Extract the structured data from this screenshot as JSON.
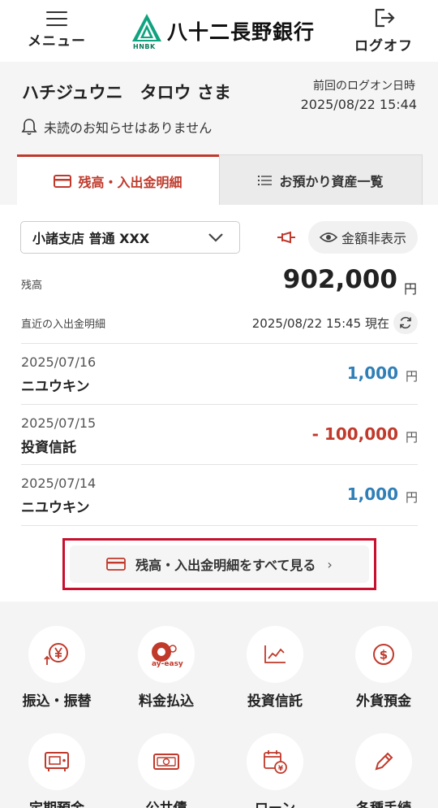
{
  "header": {
    "menu_label": "メニュー",
    "bank_name": "八十二長野銀行",
    "logo_sub": "HNBK",
    "logout_label": "ログオフ"
  },
  "user": {
    "name": "ハチジュウニ　タロウ さま",
    "last_logon_label": "前回のログオン日時",
    "last_logon_time": "2025/08/22 15:44",
    "notice": "未読のお知らせはありません"
  },
  "tabs": [
    {
      "label": "残高・入出金明細",
      "active": true
    },
    {
      "label": "お預かり資産一覧",
      "active": false
    }
  ],
  "account": {
    "selected": "小諸支店 普通 XXX",
    "hide_amount_label": "金額非表示",
    "balance_label": "残高",
    "balance_value": "902,000",
    "currency_unit": "円",
    "recent_label": "直近の入出金明細",
    "recent_time": "2025/08/22 15:45 現在"
  },
  "transactions": [
    {
      "date": "2025/07/16",
      "desc": "ニユウキン",
      "amount": "1,000",
      "unit": "円",
      "type": "deposit"
    },
    {
      "date": "2025/07/15",
      "desc": "投資信託",
      "amount": "- 100,000",
      "unit": "円",
      "type": "withdrawal"
    },
    {
      "date": "2025/07/14",
      "desc": "ニユウキン",
      "amount": "1,000",
      "unit": "円",
      "type": "deposit"
    }
  ],
  "view_all_label": "残高・入出金明細をすべて見る",
  "view_all_arrow": "›",
  "menu": [
    {
      "label": "振込・振替",
      "icon": "transfer-yen-icon"
    },
    {
      "label": "料金払込",
      "icon": "pay-easy-icon",
      "icon_text": "ay-easy"
    },
    {
      "label": "投資信託",
      "icon": "chart-line-icon"
    },
    {
      "label": "外貨預金",
      "icon": "dollar-coin-icon"
    },
    {
      "label": "定期預金",
      "icon": "safe-icon"
    },
    {
      "label": "公共債",
      "icon": "bond-bill-icon"
    },
    {
      "label": "ローン",
      "icon": "calendar-yen-icon"
    },
    {
      "label": "各種手続",
      "icon": "pencil-icon"
    }
  ],
  "colors": {
    "accent": "#c0392b",
    "deposit": "#2f7fb7",
    "highlight_border": "#c8102e",
    "logo_green": "#0a7a5a"
  }
}
